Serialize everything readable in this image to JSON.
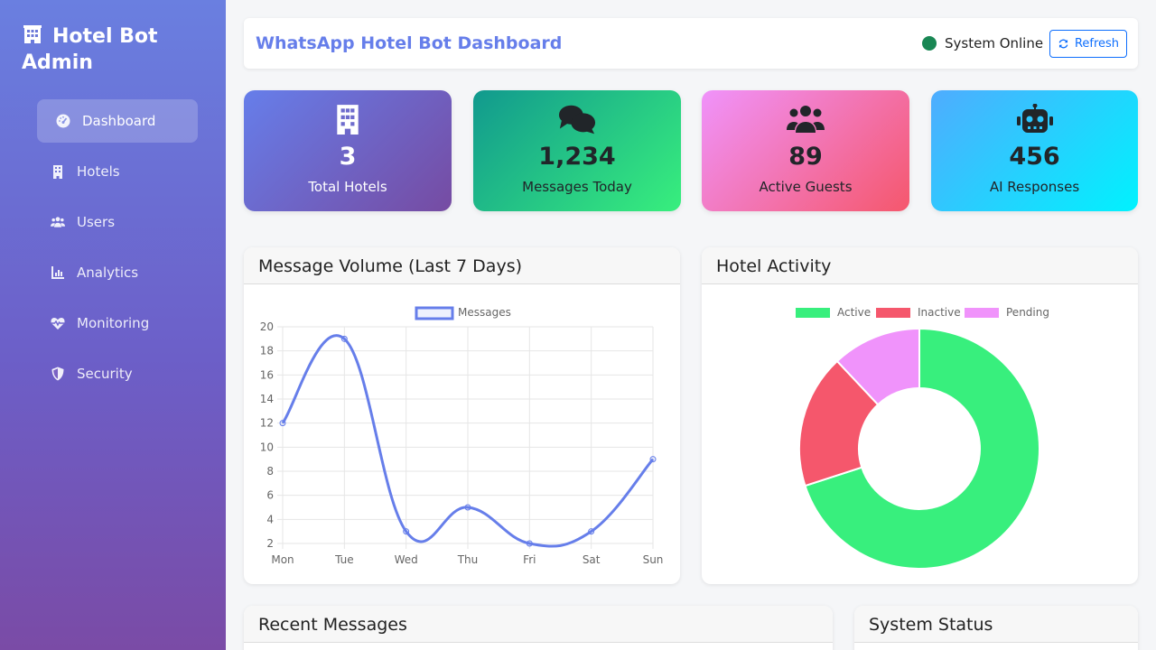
{
  "sidebar": {
    "brand": "Hotel Bot Admin",
    "brand_icon": "hotel-building-icon",
    "items": [
      {
        "label": "Dashboard",
        "icon": "gauge-icon",
        "active": true
      },
      {
        "label": "Hotels",
        "icon": "building-icon",
        "active": false
      },
      {
        "label": "Users",
        "icon": "users-icon",
        "active": false
      },
      {
        "label": "Analytics",
        "icon": "chart-bar-icon",
        "active": false
      },
      {
        "label": "Monitoring",
        "icon": "heartbeat-icon",
        "active": false
      },
      {
        "label": "Security",
        "icon": "shield-icon",
        "active": false
      }
    ]
  },
  "header": {
    "title": "WhatsApp Hotel Bot Dashboard",
    "status_text": "System Online",
    "status_color": "#198754",
    "refresh_label": "Refresh"
  },
  "stats": [
    {
      "value": "3",
      "label": "Total Hotels",
      "icon": "building-icon"
    },
    {
      "value": "1,234",
      "label": "Messages Today",
      "icon": "comments-icon"
    },
    {
      "value": "89",
      "label": "Active Guests",
      "icon": "users-icon"
    },
    {
      "value": "456",
      "label": "AI Responses",
      "icon": "robot-icon"
    }
  ],
  "panels": {
    "message_volume": "Message Volume (Last 7 Days)",
    "hotel_activity": "Hotel Activity",
    "recent_messages": "Recent Messages",
    "system_status": "System Status"
  },
  "chart_data": [
    {
      "type": "line",
      "title": "Message Volume (Last 7 Days)",
      "categories": [
        "Mon",
        "Tue",
        "Wed",
        "Thu",
        "Fri",
        "Sat",
        "Sun"
      ],
      "series": [
        {
          "name": "Messages",
          "values": [
            12,
            19,
            3,
            5,
            2,
            3,
            9
          ],
          "color": "#667eea"
        }
      ],
      "ylim": [
        2,
        20
      ],
      "yticks": [
        2,
        4,
        6,
        8,
        10,
        12,
        14,
        16,
        18,
        20
      ],
      "grid": true,
      "legend": "top"
    },
    {
      "type": "pie",
      "title": "Hotel Activity",
      "categories": [
        "Active",
        "Inactive",
        "Pending"
      ],
      "values": [
        70,
        18,
        12
      ],
      "colors": [
        "#38ef7d",
        "#f5576c",
        "#f093fb"
      ],
      "legend": "top"
    }
  ]
}
